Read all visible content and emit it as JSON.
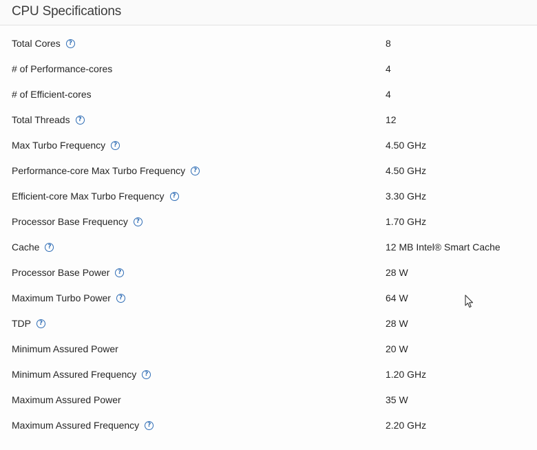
{
  "section": {
    "title": "CPU Specifications"
  },
  "specs": [
    {
      "label": "Total Cores",
      "value": "8",
      "help": true
    },
    {
      "label": "# of Performance-cores",
      "value": "4",
      "help": false
    },
    {
      "label": "# of Efficient-cores",
      "value": "4",
      "help": false
    },
    {
      "label": "Total Threads",
      "value": "12",
      "help": true
    },
    {
      "label": "Max Turbo Frequency",
      "value": "4.50 GHz",
      "help": true
    },
    {
      "label": "Performance-core Max Turbo Frequency",
      "value": "4.50 GHz",
      "help": true
    },
    {
      "label": "Efficient-core Max Turbo Frequency",
      "value": "3.30 GHz",
      "help": true
    },
    {
      "label": "Processor Base Frequency",
      "value": "1.70 GHz",
      "help": true
    },
    {
      "label": "Cache",
      "value": "12 MB Intel® Smart Cache",
      "help": true
    },
    {
      "label": "Processor Base Power",
      "value": "28 W",
      "help": true
    },
    {
      "label": "Maximum Turbo Power",
      "value": "64 W",
      "help": true
    },
    {
      "label": "TDP",
      "value": "28 W",
      "help": true
    },
    {
      "label": "Minimum Assured Power",
      "value": "20 W",
      "help": false
    },
    {
      "label": "Minimum Assured Frequency",
      "value": "1.20 GHz",
      "help": true
    },
    {
      "label": "Maximum Assured Power",
      "value": "35 W",
      "help": false
    },
    {
      "label": "Maximum Assured Frequency",
      "value": "2.20 GHz",
      "help": true
    }
  ],
  "icons": {
    "help": "question-circle-icon",
    "cursor": "mouse-pointer-icon"
  },
  "colors": {
    "help_icon": "#2f6db5",
    "text": "#262626",
    "title": "#3c3c3c"
  }
}
